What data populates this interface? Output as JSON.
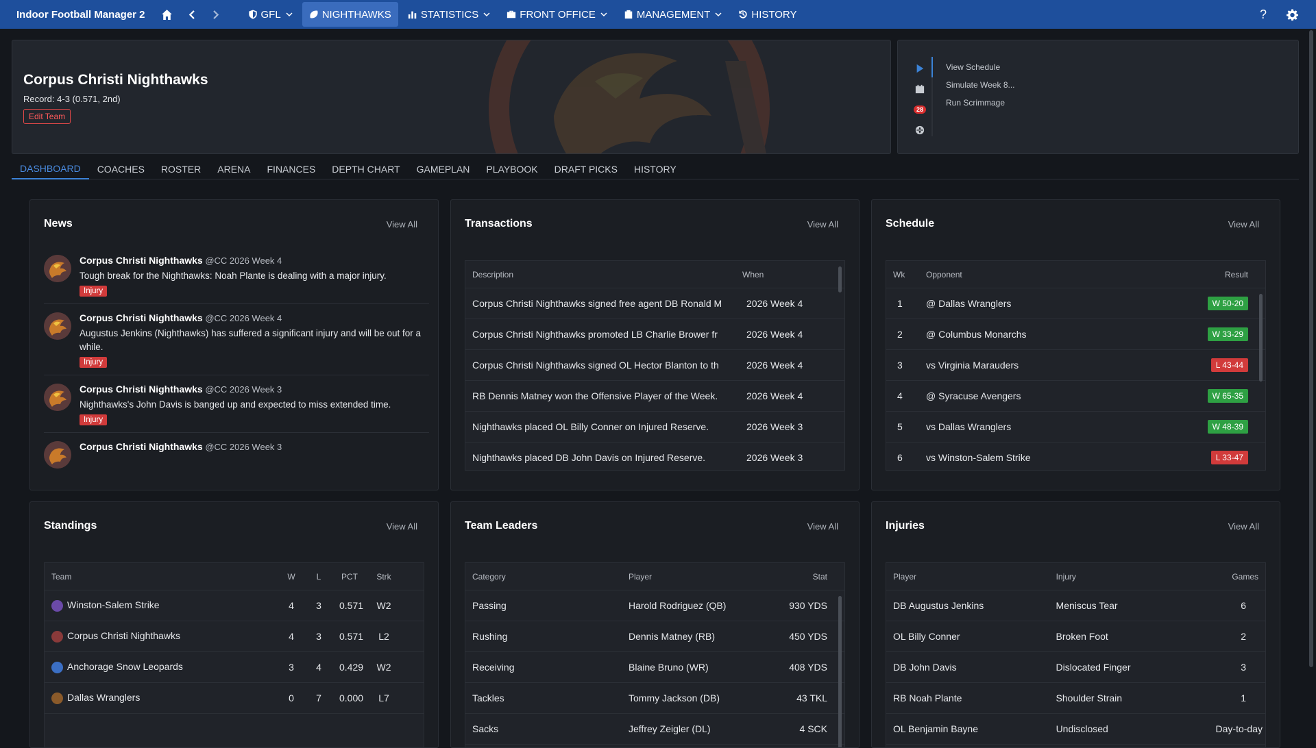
{
  "topbar": {
    "app_title": "Indoor Football Manager 2",
    "menus": [
      {
        "label": "GFL",
        "active": false
      },
      {
        "label": "NIGHTHAWKS",
        "active": true
      },
      {
        "label": "STATISTICS",
        "active": false
      },
      {
        "label": "FRONT OFFICE",
        "active": false
      },
      {
        "label": "MANAGEMENT",
        "active": false
      },
      {
        "label": "HISTORY",
        "active": false
      }
    ],
    "help_label": "?"
  },
  "team": {
    "name": "Corpus Christi Nighthawks",
    "record": "Record: 4-3 (0.571, 2nd)",
    "edit_label": "Edit Team"
  },
  "actions": {
    "badge": "28",
    "items": [
      "View Schedule",
      "Simulate Week 8...",
      "Run Scrimmage"
    ]
  },
  "tabs": [
    "DASHBOARD",
    "COACHES",
    "ROSTER",
    "ARENA",
    "FINANCES",
    "DEPTH CHART",
    "GAMEPLAN",
    "PLAYBOOK",
    "DRAFT PICKS",
    "HISTORY"
  ],
  "view_all": "View All",
  "news": {
    "title": "News",
    "items": [
      {
        "author": "Corpus Christi Nighthawks",
        "meta": "@CC 2026 Week 4",
        "text": "Tough break for the Nighthawks: Noah Plante is dealing with a major injury.",
        "tag": "Injury"
      },
      {
        "author": "Corpus Christi Nighthawks",
        "meta": "@CC 2026 Week 4",
        "text": "Augustus Jenkins (Nighthawks) has suffered a significant injury and will be out for a while.",
        "tag": "Injury"
      },
      {
        "author": "Corpus Christi Nighthawks",
        "meta": "@CC 2026 Week 3",
        "text": "Nighthawks's John Davis is banged up and expected to miss extended time.",
        "tag": "Injury"
      },
      {
        "author": "Corpus Christi Nighthawks",
        "meta": "@CC 2026 Week 3",
        "text": "",
        "tag": ""
      }
    ]
  },
  "transactions": {
    "title": "Transactions",
    "headers": [
      "Description",
      "When"
    ],
    "rows": [
      [
        "Corpus Christi Nighthawks signed free agent DB Ronald M",
        "2026 Week 4"
      ],
      [
        "Corpus Christi Nighthawks promoted LB Charlie Brower fr",
        "2026 Week 4"
      ],
      [
        "Corpus Christi Nighthawks signed OL Hector Blanton to th",
        "2026 Week 4"
      ],
      [
        "RB Dennis Matney won the Offensive Player of the Week.",
        "2026 Week 4"
      ],
      [
        "Nighthawks placed OL Billy Conner on Injured Reserve.",
        "2026 Week 3"
      ],
      [
        "Nighthawks placed DB John Davis on Injured Reserve.",
        "2026 Week 3"
      ]
    ]
  },
  "schedule": {
    "title": "Schedule",
    "headers": [
      "Wk",
      "Opponent",
      "Result"
    ],
    "rows": [
      {
        "wk": "1",
        "opp": "@ Dallas Wranglers",
        "res": "W 50-20",
        "win": true
      },
      {
        "wk": "2",
        "opp": "@ Columbus Monarchs",
        "res": "W 33-29",
        "win": true
      },
      {
        "wk": "3",
        "opp": "vs Virginia Marauders",
        "res": "L 43-44",
        "win": false
      },
      {
        "wk": "4",
        "opp": "@ Syracuse Avengers",
        "res": "W 65-35",
        "win": true
      },
      {
        "wk": "5",
        "opp": "vs Dallas Wranglers",
        "res": "W 48-39",
        "win": true
      },
      {
        "wk": "6",
        "opp": "vs Winston-Salem Strike",
        "res": "L 33-47",
        "win": false
      }
    ]
  },
  "standings": {
    "title": "Standings",
    "headers": [
      "Team",
      "W",
      "L",
      "PCT",
      "Strk"
    ],
    "rows": [
      {
        "team": "Winston-Salem Strike",
        "w": "4",
        "l": "3",
        "pct": "0.571",
        "strk": "W2",
        "color": "#6b4aa8",
        "hl": false
      },
      {
        "team": "Corpus Christi Nighthawks",
        "w": "4",
        "l": "3",
        "pct": "0.571",
        "strk": "L2",
        "color": "#8a3a3a",
        "hl": true
      },
      {
        "team": "Anchorage Snow Leopards",
        "w": "3",
        "l": "4",
        "pct": "0.429",
        "strk": "W2",
        "color": "#3b6fc4",
        "hl": false
      },
      {
        "team": "Dallas Wranglers",
        "w": "0",
        "l": "7",
        "pct": "0.000",
        "strk": "L7",
        "color": "#8a5a2a",
        "hl": false
      }
    ]
  },
  "leaders": {
    "title": "Team Leaders",
    "headers": [
      "Category",
      "Player",
      "Stat"
    ],
    "rows": [
      [
        "Passing",
        "Harold Rodriguez (QB)",
        "930 YDS"
      ],
      [
        "Rushing",
        "Dennis Matney (RB)",
        "450 YDS"
      ],
      [
        "Receiving",
        "Blaine Bruno (WR)",
        "408 YDS"
      ],
      [
        "Tackles",
        "Tommy Jackson (DB)",
        "43 TKL"
      ],
      [
        "Sacks",
        "Jeffrey Zeigler (DL)",
        "4 SCK"
      ]
    ]
  },
  "injuries": {
    "title": "Injuries",
    "headers": [
      "Player",
      "Injury",
      "Games"
    ],
    "rows": [
      [
        "DB Augustus Jenkins",
        "Meniscus Tear",
        "6"
      ],
      [
        "OL Billy Conner",
        "Broken Foot",
        "2"
      ],
      [
        "DB John Davis",
        "Dislocated Finger",
        "3"
      ],
      [
        "RB Noah Plante",
        "Shoulder Strain",
        "1"
      ],
      [
        "OL Benjamin Bayne",
        "Undisclosed",
        "Day-to-day"
      ]
    ]
  },
  "colors": {
    "topbar": "#1e4f9c",
    "accent": "#3b82d6",
    "win": "#2ea043",
    "loss": "#d13b3b"
  }
}
